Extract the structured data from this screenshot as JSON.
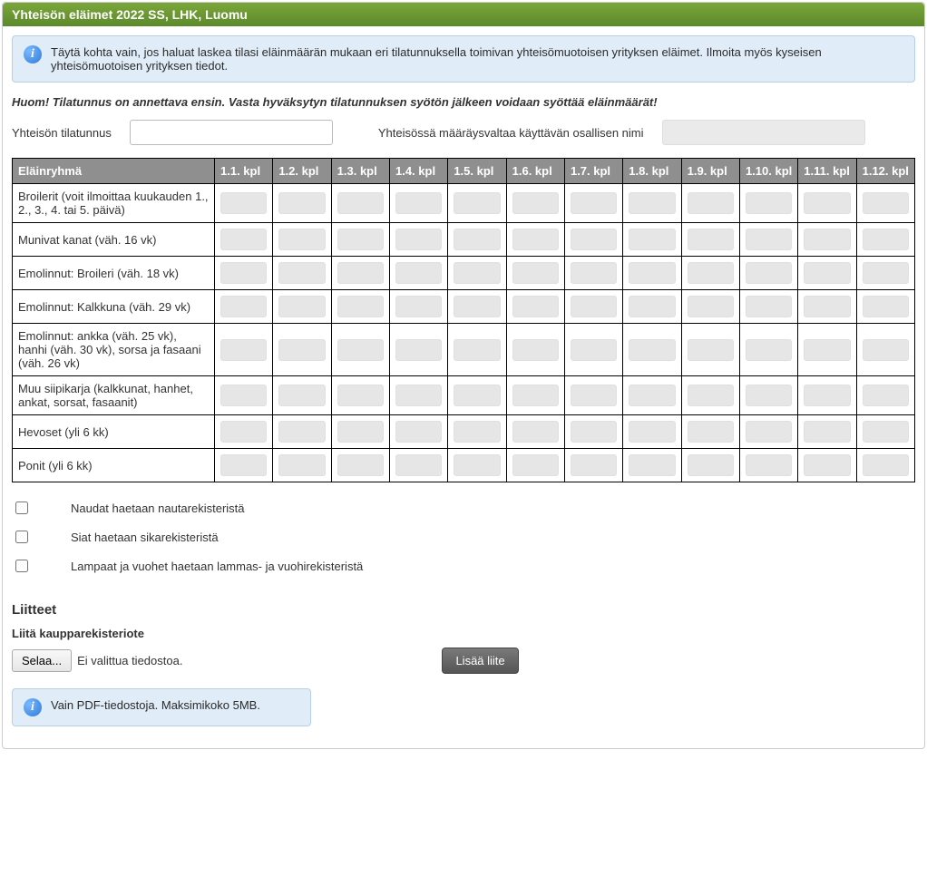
{
  "panel": {
    "title": "Yhteisön eläimet 2022 SS, LHK, Luomu"
  },
  "info1": "Täytä kohta vain, jos haluat laskea tilasi eläinmäärän mukaan eri tilatunnuksella toimivan yhteisömuotoisen yrityksen eläimet. Ilmoita myös kyseisen yhteisömuotoisen yrityksen tiedot.",
  "notice": "Huom! Tilatunnus on annettava ensin. Vasta hyväksytyn tilatunnuksen syötön jälkeen voidaan syöttää eläinmäärät!",
  "fields": {
    "tilatunnus_label": "Yhteisön tilatunnus",
    "tilatunnus_value": "",
    "osallinen_label": "Yhteisössä määräysvaltaa käyttävän osallisen nimi",
    "osallinen_value": ""
  },
  "table": {
    "col0": "Eläinryhmä",
    "cols": [
      "1.1. kpl",
      "1.2. kpl",
      "1.3. kpl",
      "1.4. kpl",
      "1.5. kpl",
      "1.6. kpl",
      "1.7. kpl",
      "1.8. kpl",
      "1.9. kpl",
      "1.10. kpl",
      "1.11. kpl",
      "1.12. kpl"
    ],
    "rows": [
      "Broilerit (voit ilmoittaa kuukauden 1., 2., 3., 4. tai 5. päivä)",
      "Munivat kanat (väh. 16 vk)",
      "Emolinnut: Broileri (väh. 18 vk)",
      "Emolinnut: Kalkkuna (väh. 29 vk)",
      "Emolinnut: ankka (väh. 25 vk), hanhi (väh. 30 vk), sorsa ja fasaani (väh. 26 vk)",
      "Muu siipikarja (kalkkunat, hanhet, ankat, sorsat, fasaanit)",
      "Hevoset (yli 6 kk)",
      "Ponit (yli 6 kk)"
    ]
  },
  "checks": [
    "Naudat haetaan nautarekisteristä",
    "Siat haetaan sikarekisteristä",
    "Lampaat ja vuohet haetaan lammas- ja vuohirekisteristä"
  ],
  "attachments": {
    "heading": "Liitteet",
    "sublabel": "Liitä kaupparekisteriote",
    "browse": "Selaa...",
    "nofile": "Ei valittua tiedostoa.",
    "add": "Lisää liite",
    "pdfinfo": "Vain PDF-tiedostoja. Maksimikoko 5MB."
  }
}
